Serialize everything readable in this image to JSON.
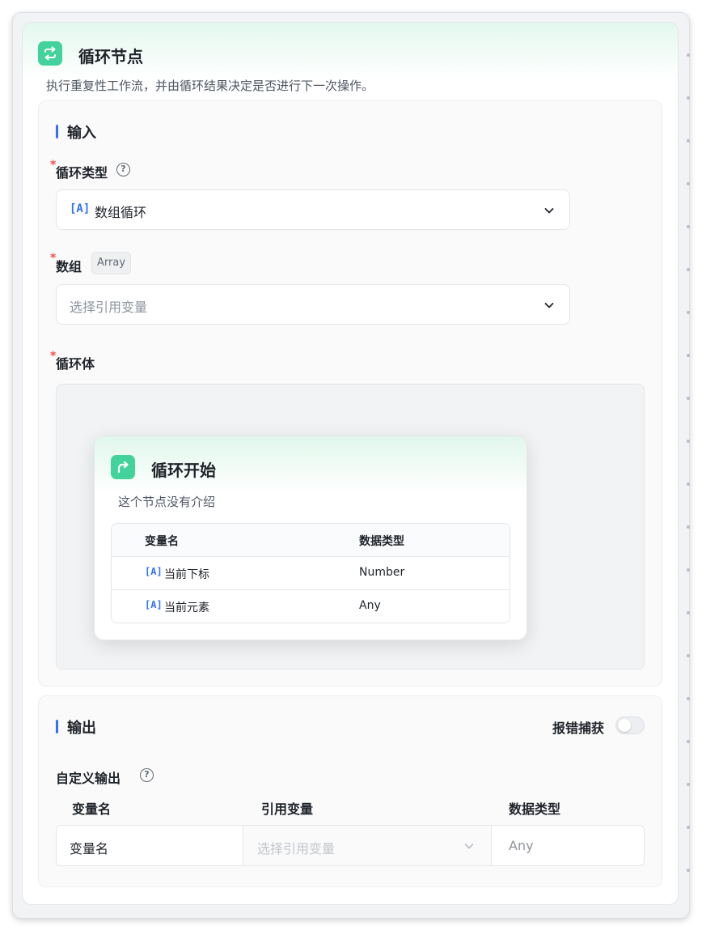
{
  "node": {
    "title": "循环节点",
    "description": "执行重复性工作流，并由循环结果决定是否进行下一次操作。",
    "icon": "loop-arrows-icon",
    "accent_color": "#41d39b"
  },
  "input_section": {
    "title": "输入",
    "loop_type": {
      "label": "循环类型",
      "required_mark": "*",
      "help_icon": "question-circle-icon",
      "type_tag": "[A]",
      "value": "数组循环"
    },
    "array": {
      "label": "数组",
      "required_mark": "*",
      "type_badge": "Array",
      "placeholder": "选择引用变量"
    },
    "loop_body": {
      "label": "循环体",
      "required_mark": "*",
      "start_node": {
        "title": "循环开始",
        "icon": "loop-start-icon",
        "description": "这个节点没有介绍",
        "columns": [
          "变量名",
          "数据类型"
        ],
        "rows": [
          {
            "tag": "[A]",
            "name": "当前下标",
            "type": "Number"
          },
          {
            "tag": "[A]",
            "name": "当前元素",
            "type": "Any"
          }
        ]
      }
    }
  },
  "output_section": {
    "title": "输出",
    "error_catch_label": "报错捕获",
    "error_catch_enabled": false,
    "custom_output": {
      "label": "自定义输出",
      "help_icon": "question-circle-icon",
      "columns": [
        "变量名",
        "引用变量",
        "数据类型"
      ],
      "row": {
        "name_placeholder": "变量名",
        "ref_placeholder": "选择引用变量",
        "type_value": "Any"
      }
    }
  },
  "colors": {
    "accent_blue": "#3370ff",
    "required_red": "#f54a45"
  }
}
